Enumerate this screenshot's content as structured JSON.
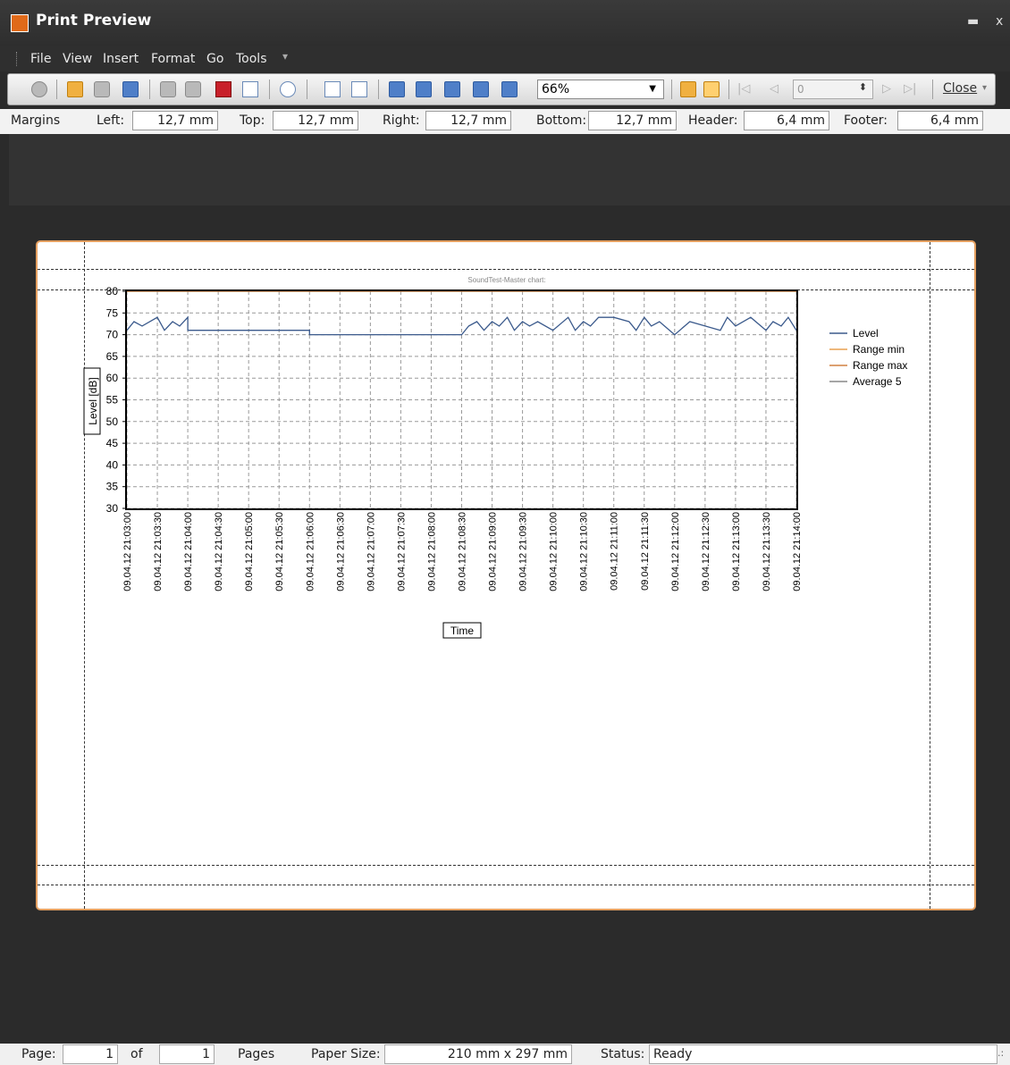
{
  "window": {
    "title": "Print Preview"
  },
  "menu": {
    "items": [
      "File",
      "View",
      "Insert",
      "Format",
      "Go",
      "Tools"
    ]
  },
  "toolbar": {
    "zoom_value": "66%",
    "page_number": "0",
    "close_label": "Close"
  },
  "margins": {
    "label": "Margins",
    "left_label": "Left:",
    "left_value": "12,7 mm",
    "top_label": "Top:",
    "top_value": "12,7 mm",
    "right_label": "Right:",
    "right_value": "12,7 mm",
    "bottom_label": "Bottom:",
    "bottom_value": "12,7 mm",
    "header_label": "Header:",
    "header_value": "6,4 mm",
    "footer_label": "Footer:",
    "footer_value": "6,4 mm"
  },
  "status": {
    "page_label": "Page:",
    "page_value": "1",
    "of_label": "of",
    "total_value": "1",
    "pages_label": "Pages",
    "paper_label": "Paper Size:",
    "paper_value": "210 mm x 297 mm",
    "status_label": "Status:",
    "status_value": "Ready"
  },
  "chart_data": {
    "type": "line",
    "title": "SoundTest-Master chart:",
    "xlabel": "Time",
    "ylabel": "Level [dB]",
    "ylim": [
      30,
      80
    ],
    "yticks": [
      30,
      35,
      40,
      45,
      50,
      55,
      60,
      65,
      70,
      75,
      80
    ],
    "ytick_labels": [
      "30",
      "35",
      "40",
      "45",
      "50",
      "55",
      "60",
      "65",
      "70",
      "75",
      "80"
    ],
    "x_tick_labels": [
      "09.04.12 21:03:00",
      "09.04.12 21:03:30",
      "09.04.12 21:04:00",
      "09.04.12 21:04:30",
      "09.04.12 21:05:00",
      "09.04.12 21:05:30",
      "09.04.12 21:06:00",
      "09.04.12 21:06:30",
      "09.04.12 21:07:00",
      "09.04.12 21:07:30",
      "09.04.12 21:08:00",
      "09.04.12 21:08:30",
      "09.04.12 21:09:00",
      "09.04.12 21:09:30",
      "09.04.12 21:10:00",
      "09.04.12 21:10:30",
      "09.04.12 21:11:00",
      "09.04.12 21:11:30",
      "09.04.12 21:12:00",
      "09.04.12 21:12:30",
      "09.04.12 21:13:00",
      "09.04.12 21:13:30",
      "09.04.12 21:14:00"
    ],
    "legend_position": "right",
    "grid": true,
    "series": [
      {
        "name": "Level",
        "color": "#3b5a8c",
        "x": [
          "09.04.12 21:03:00",
          "09.04.12 21:03:07",
          "09.04.12 21:03:15",
          "09.04.12 21:03:30",
          "09.04.12 21:03:37",
          "09.04.12 21:03:45",
          "09.04.12 21:03:52",
          "09.04.12 21:04:00",
          "09.04.12 21:04:00",
          "09.04.12 21:06:00",
          "09.04.12 21:06:00",
          "09.04.12 21:08:30",
          "09.04.12 21:08:37",
          "09.04.12 21:08:45",
          "09.04.12 21:08:52",
          "09.04.12 21:09:00",
          "09.04.12 21:09:07",
          "09.04.12 21:09:15",
          "09.04.12 21:09:22",
          "09.04.12 21:09:30",
          "09.04.12 21:09:37",
          "09.04.12 21:09:45",
          "09.04.12 21:10:00",
          "09.04.12 21:10:15",
          "09.04.12 21:10:22",
          "09.04.12 21:10:30",
          "09.04.12 21:10:37",
          "09.04.12 21:10:45",
          "09.04.12 21:11:00",
          "09.04.12 21:11:15",
          "09.04.12 21:11:22",
          "09.04.12 21:11:30",
          "09.04.12 21:11:37",
          "09.04.12 21:11:45",
          "09.04.12 21:12:00",
          "09.04.12 21:12:15",
          "09.04.12 21:12:30",
          "09.04.12 21:12:45",
          "09.04.12 21:12:52",
          "09.04.12 21:13:00",
          "09.04.12 21:13:15",
          "09.04.12 21:13:30",
          "09.04.12 21:13:37",
          "09.04.12 21:13:45",
          "09.04.12 21:13:52",
          "09.04.12 21:14:00"
        ],
        "y": [
          71,
          73,
          72,
          74,
          71,
          73,
          72,
          74,
          71,
          71,
          70,
          70,
          72,
          73,
          71,
          73,
          72,
          74,
          71,
          73,
          72,
          73,
          71,
          74,
          71,
          73,
          72,
          74,
          74,
          73,
          71,
          74,
          72,
          73,
          70,
          73,
          72,
          71,
          74,
          72,
          74,
          71,
          73,
          72,
          74,
          71
        ]
      },
      {
        "name": "Range min",
        "color": "#e8a050",
        "x": [
          "09.04.12 21:03:00",
          "09.04.12 21:14:00"
        ],
        "y": [
          80,
          80
        ]
      },
      {
        "name": "Range max",
        "color": "#d08040",
        "x": [
          "09.04.12 21:03:00",
          "09.04.12 21:14:00"
        ],
        "y": [
          80,
          80
        ]
      },
      {
        "name": "Average 5",
        "color": "#888888",
        "x": [],
        "y": []
      }
    ]
  }
}
